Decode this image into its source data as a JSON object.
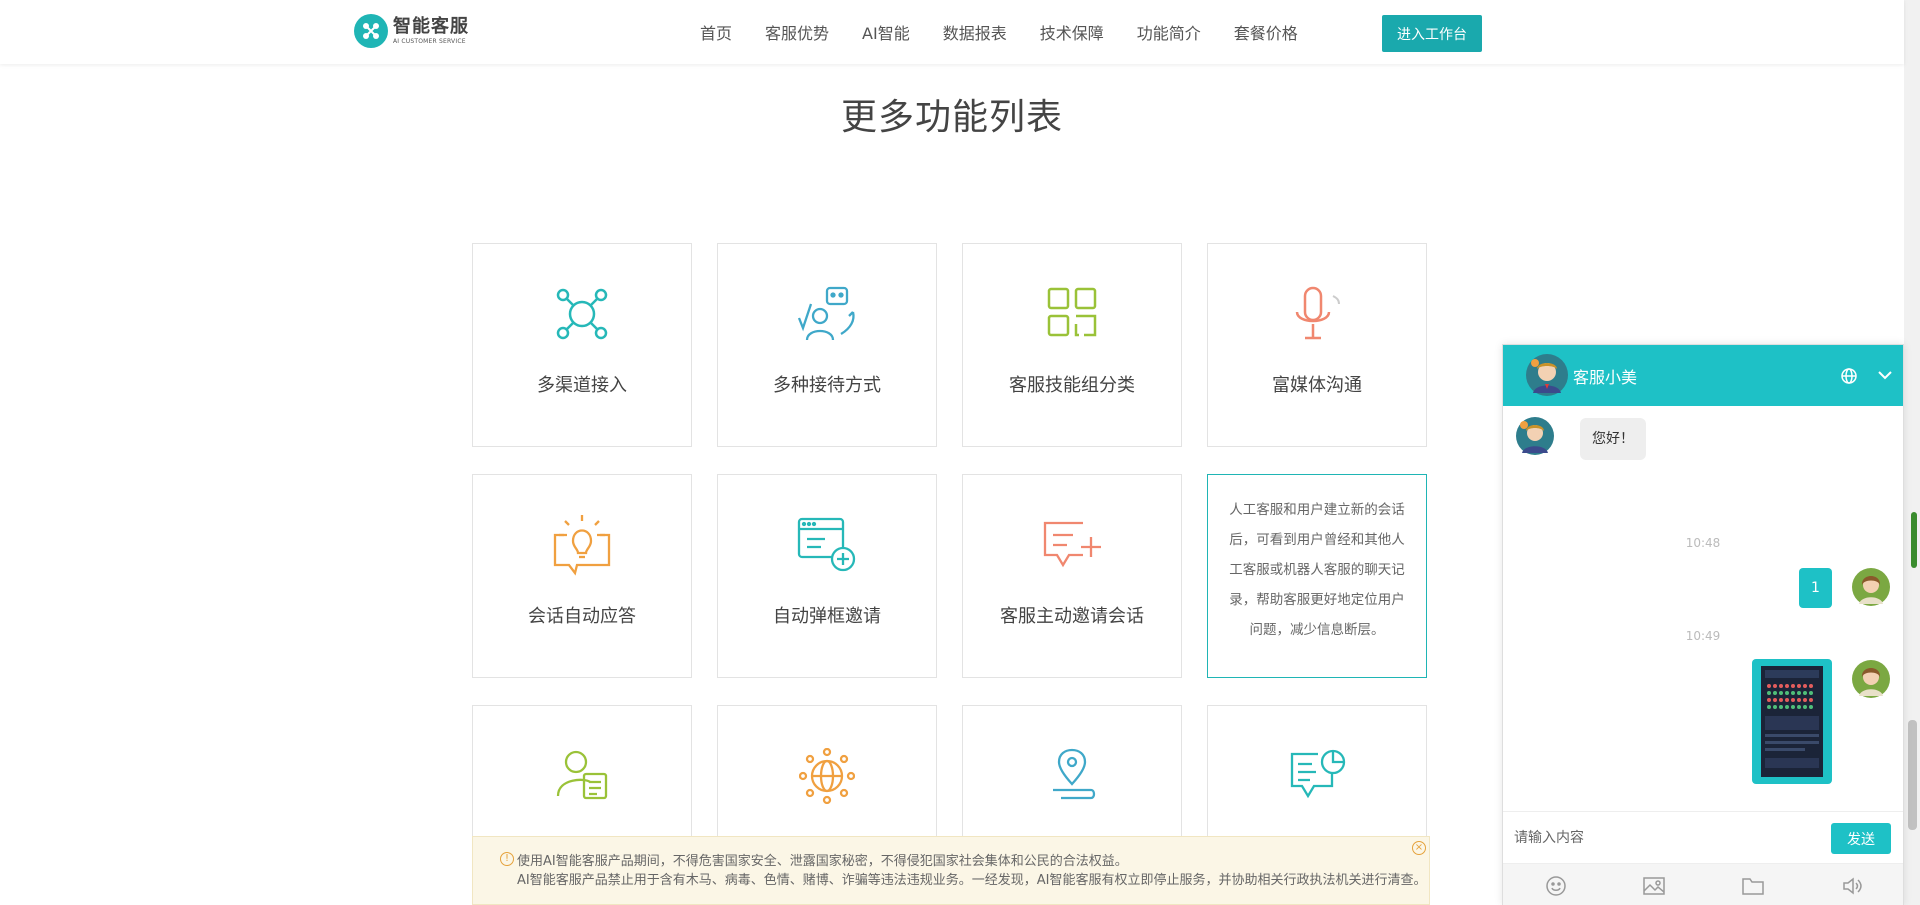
{
  "header": {
    "logo_title": "智能客服",
    "logo_sub": "AI CUSTOMER SERVICE",
    "nav": [
      "首页",
      "客服优势",
      "AI智能",
      "数据报表",
      "技术保障",
      "功能简介",
      "套餐价格"
    ],
    "workbench_label": "进入工作台"
  },
  "section_title": "更多功能列表",
  "cards": [
    {
      "label": "多渠道接入",
      "icon": "network-nodes-icon",
      "color": "#26b8b8"
    },
    {
      "label": "多种接待方式",
      "icon": "agent-robot-icon",
      "color": "#3fa8c9"
    },
    {
      "label": "客服技能组分类",
      "icon": "grid-squares-icon",
      "color": "#9ac238"
    },
    {
      "label": "富媒体沟通",
      "icon": "microphone-icon",
      "color": "#f0876f"
    },
    {
      "label": "会话自动应答",
      "icon": "lightbulb-chat-icon",
      "color": "#f0a040"
    },
    {
      "label": "自动弹框邀请",
      "icon": "browser-add-icon",
      "color": "#26b8b8"
    },
    {
      "label": "客服主动邀请会话",
      "icon": "chat-add-icon",
      "color": "#f0876f"
    },
    {
      "label": "",
      "icon": "",
      "color": "#1fb5b5"
    },
    {
      "label": "",
      "icon": "user-card-icon",
      "color": "#9ac238"
    },
    {
      "label": "",
      "icon": "globe-network-icon",
      "color": "#f0a040"
    },
    {
      "label": "",
      "icon": "location-pin-icon",
      "color": "#3fa8c9"
    },
    {
      "label": "",
      "icon": "chat-chart-icon",
      "color": "#26b8b8"
    }
  ],
  "active_card_desc": "人工客服和用户建立新的会话后，可看到用户曾经和其他人工客服或机器人客服的聊天记录，帮助客服更好地定位用户问题，减少信息断层。",
  "notice": {
    "line1": "使用AI智能客服产品期间，不得危害国家安全、泄露国家秘密，不得侵犯国家社会集体和公民的合法权益。",
    "line2": "AI智能客服产品禁止用于含有木马、病毒、色情、赌博、诈骗等违法违规业务。一经发现，AI智能客服有权立即停止服务，并协助相关行政执法机关进行清查。"
  },
  "chat": {
    "agent_name": "客服小美",
    "greeting": "您好！",
    "time1": "10:48",
    "user_msg": "1",
    "time2": "10:49",
    "input_placeholder": "请输入内容",
    "send_label": "发送",
    "accent": "#1ec1c6"
  }
}
